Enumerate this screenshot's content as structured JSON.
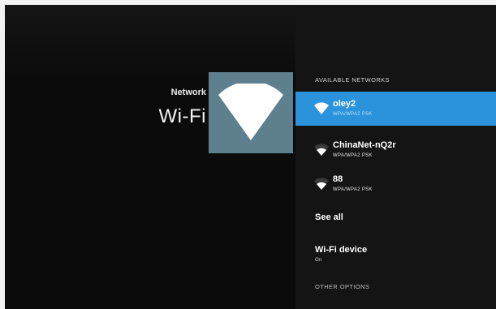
{
  "header": {
    "section": "Network",
    "title": "Wi-Fi",
    "hero_icon": "wifi-icon"
  },
  "panel": {
    "available_header": "AVAILABLE NETWORKS",
    "networks": [
      {
        "name": "oley2",
        "security": "WPA/WPA2 PSK",
        "selected": true,
        "icon": "wifi-icon"
      },
      {
        "name": "ChinaNet-nQ2r",
        "security": "WPA/WPA2 PSK",
        "selected": false,
        "icon": "wifi-icon"
      },
      {
        "name": "88",
        "security": "WPA/WPA2 PSK",
        "selected": false,
        "icon": "wifi-icon"
      }
    ],
    "see_all": "See all",
    "wifi_device": {
      "label": "Wi-Fi device",
      "status": "On"
    },
    "other_options": "OTHER OPTIONS"
  },
  "colors": {
    "background": "#0b0b0b",
    "accent": "#2a93dc",
    "hero_tile": "#5e7f8e"
  }
}
